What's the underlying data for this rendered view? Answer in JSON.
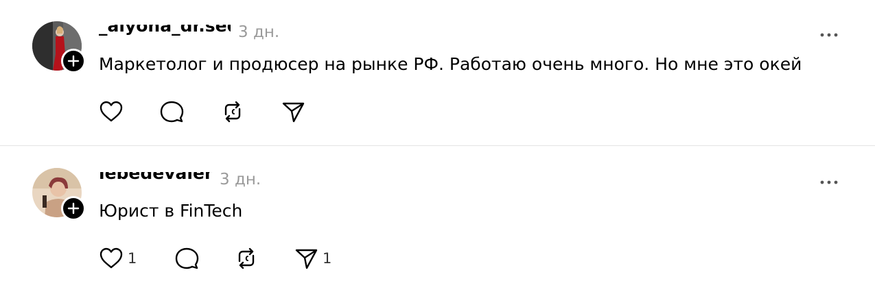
{
  "posts": [
    {
      "username": "_alyona_dr.sed",
      "time": "3 дн.",
      "text": "Маркетолог и продюсер на рынке РФ. Работаю очень много. Но мне это окей",
      "likes": "",
      "shares": "",
      "avatar_icon": "user-avatar",
      "follow_icon": "plus-icon"
    },
    {
      "username": "lebedevalena",
      "time": "3 дн.",
      "text": "Юрист в FinTech",
      "likes": "1",
      "shares": "1",
      "avatar_icon": "user-avatar",
      "follow_icon": "plus-icon"
    }
  ],
  "icons": {
    "more": "more-horizontal-icon",
    "like": "heart-icon",
    "reply": "comment-bubble-icon",
    "repost": "repost-icon",
    "share": "send-icon"
  },
  "colors": {
    "text": "#000000",
    "muted": "#9a9a9a",
    "divider": "#e4e4e4",
    "icon": "#000000"
  }
}
